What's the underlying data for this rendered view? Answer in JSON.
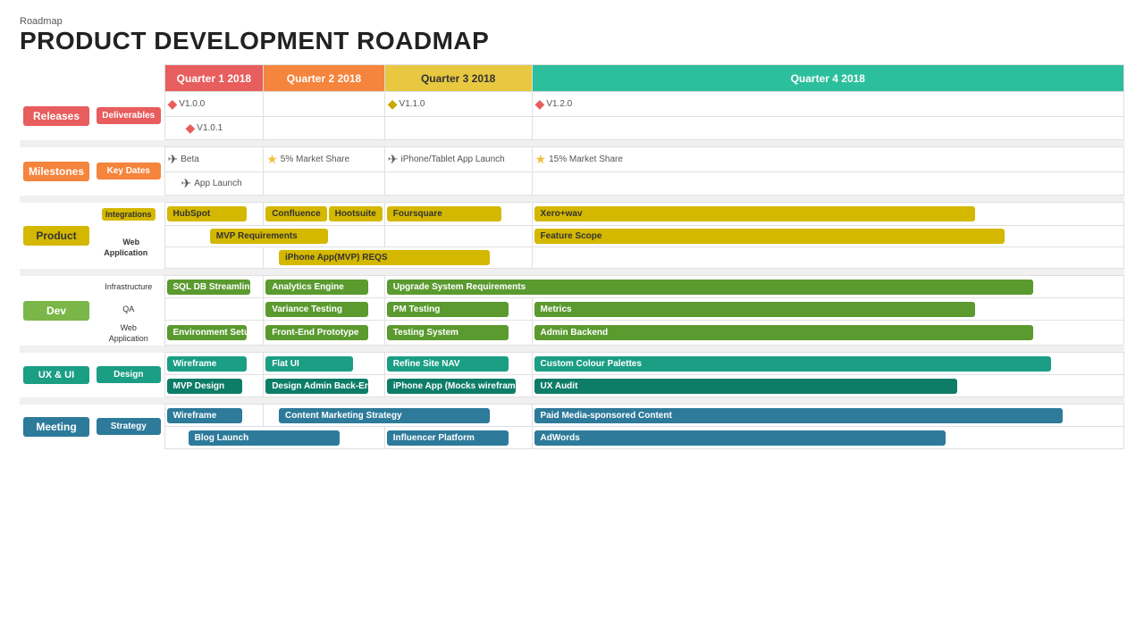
{
  "header": {
    "label": "Roadmap",
    "title": "PRODUCT DEVELOPMENT ROADMAP"
  },
  "quarters": [
    {
      "label": "Quarter 1 2018",
      "class": "q1"
    },
    {
      "label": "Quarter 2 2018",
      "class": "q2"
    },
    {
      "label": "Quarter 3 2018",
      "class": "q3"
    },
    {
      "label": "Quarter 4 2018",
      "class": "q4"
    }
  ],
  "sections": {
    "releases": {
      "label": "Releases",
      "sub": "Deliverables",
      "releases": [
        {
          "label": "V1.0.0",
          "quarter": 1,
          "pos": "early"
        },
        {
          "label": "V1.0.1",
          "quarter": 1,
          "pos": "late"
        },
        {
          "label": "V1.1.0",
          "quarter": 3,
          "pos": "early"
        },
        {
          "label": "V1.2.0",
          "quarter": 4,
          "pos": "early"
        }
      ]
    },
    "milestones": {
      "label": "Milestones",
      "sub": "Key Dates",
      "items": [
        {
          "label": "Beta",
          "quarter": 1,
          "type": "plane"
        },
        {
          "label": "App Launch",
          "quarter": 1,
          "type": "plane",
          "row": 2
        },
        {
          "label": "5% Market Share",
          "quarter": 2,
          "type": "star"
        },
        {
          "label": "iPhone/Tablet App Launch",
          "quarter": 3,
          "type": "plane"
        },
        {
          "label": "15% Market Share",
          "quarter": 3,
          "type": "star",
          "row": 2
        }
      ]
    },
    "product": {
      "label": "Product",
      "subs": [
        {
          "name": "Integrations",
          "bars": [
            {
              "label": "HubSpot",
              "q": 1,
              "color": "bar-yellow"
            },
            {
              "label": "Confluence",
              "q": 2,
              "color": "bar-yellow"
            },
            {
              "label": "Hootsuite",
              "q": 2,
              "color": "bar-yellow"
            },
            {
              "label": "Foursquare",
              "q": 3,
              "color": "bar-yellow"
            },
            {
              "label": "Xero+wav",
              "q": 4,
              "color": "bar-yellow"
            }
          ]
        },
        {
          "name": "Web Application",
          "bars": [
            {
              "label": "MVP Requirements",
              "q": "1-2",
              "color": "bar-yellow"
            },
            {
              "label": "iPhone App(MVP) REQS",
              "q": "2-3",
              "color": "bar-yellow"
            },
            {
              "label": "Feature Scope",
              "q": 4,
              "color": "bar-yellow"
            }
          ]
        }
      ]
    },
    "dev": {
      "label": "Dev",
      "subs": [
        {
          "name": "Infrastructure",
          "bars": [
            {
              "label": "SQL DB Streamline",
              "q": 1,
              "color": "bar-green-dark"
            },
            {
              "label": "Analytics Engine",
              "q": "2",
              "color": "bar-green-dark"
            },
            {
              "label": "Upgrade System Requirements",
              "q": "3-4",
              "color": "bar-green-dark"
            }
          ]
        },
        {
          "name": "QA",
          "bars": [
            {
              "label": "Variance Testing",
              "q": "1-2",
              "color": "bar-green-dark"
            },
            {
              "label": "PM Testing",
              "q": 3,
              "color": "bar-green-dark"
            },
            {
              "label": "Metrics",
              "q": 4,
              "color": "bar-green-dark"
            }
          ]
        },
        {
          "name": "Web Application",
          "bars": [
            {
              "label": "Environment Setup",
              "q": 1,
              "color": "bar-green-dark"
            },
            {
              "label": "Front-End Prototype",
              "q": "1-2",
              "color": "bar-green-dark"
            },
            {
              "label": "Testing System",
              "q": 3,
              "color": "bar-green-dark"
            },
            {
              "label": "Admin Backend",
              "q": 4,
              "color": "bar-green-dark"
            }
          ]
        }
      ]
    },
    "ux": {
      "label": "UX & UI",
      "sub": "Design",
      "bars_row1": [
        {
          "label": "Wireframe",
          "q": 1,
          "color": "bar-teal"
        },
        {
          "label": "Flat UI",
          "q": "2",
          "color": "bar-teal"
        },
        {
          "label": "Refine Site NAV",
          "q": 3,
          "color": "bar-teal"
        },
        {
          "label": "Custom Colour Palettes",
          "q": 4,
          "color": "bar-teal"
        }
      ],
      "bars_row2": [
        {
          "label": "MVP Design",
          "q": 1,
          "color": "bar-teal-dark"
        },
        {
          "label": "Design Admin Back-End",
          "q": "1-2",
          "color": "bar-teal-dark"
        },
        {
          "label": "iPhone App (Mocks wireframe)",
          "q": "2-3",
          "color": "bar-teal-dark"
        },
        {
          "label": "UX Audit",
          "q": 4,
          "color": "bar-teal-dark"
        }
      ]
    },
    "meeting": {
      "label": "Meeting",
      "sub": "Strategy",
      "bars_row1": [
        {
          "label": "Wireframe",
          "q": 1,
          "color": "bar-slate"
        },
        {
          "label": "Content Marketing Strategy",
          "q": "2-3",
          "color": "bar-slate"
        },
        {
          "label": "Paid Media-sponsored Content",
          "q": "3-4",
          "color": "bar-slate"
        }
      ],
      "bars_row2": [
        {
          "label": "Blog Launch",
          "q": "1-2",
          "color": "bar-slate"
        },
        {
          "label": "Influencer Platform",
          "q": 3,
          "color": "bar-slate"
        },
        {
          "label": "AdWords",
          "q": 4,
          "color": "bar-slate"
        }
      ]
    }
  }
}
